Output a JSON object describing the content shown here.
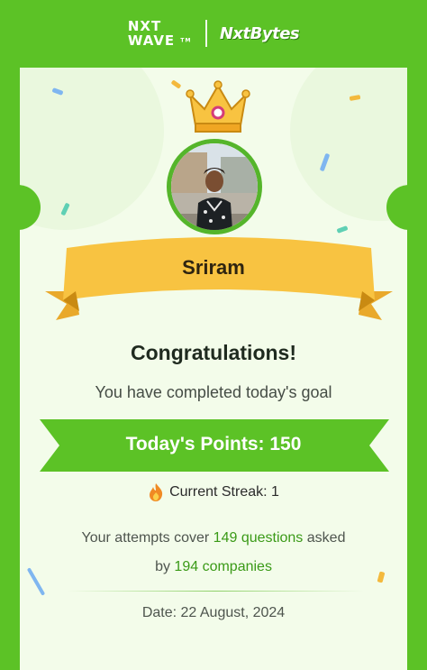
{
  "header": {
    "brand_line1": "NXT",
    "brand_line2": "WAVE",
    "brand_tm": "TM",
    "partner": "NxtBytes"
  },
  "certificate": {
    "name": "Sriram",
    "title": "Congratulations!",
    "subtitle": "You have completed today's goal",
    "points_label": "Today's Points: 150",
    "streak_label": "Current Streak: 1",
    "stats_prefix": "Your attempts cover",
    "questions": "149 questions",
    "stats_middle": "asked",
    "stats_by": "by",
    "companies": "194 companies",
    "date_label": "Date: 22 August, 2024"
  },
  "colors": {
    "brand_green": "#5cc226",
    "card_bg": "#f3fcea",
    "ribbon_yellow": "#f8c341",
    "highlight_green": "#3a9a17"
  },
  "icons": [
    "crown-icon",
    "fire-icon",
    "confetti"
  ]
}
